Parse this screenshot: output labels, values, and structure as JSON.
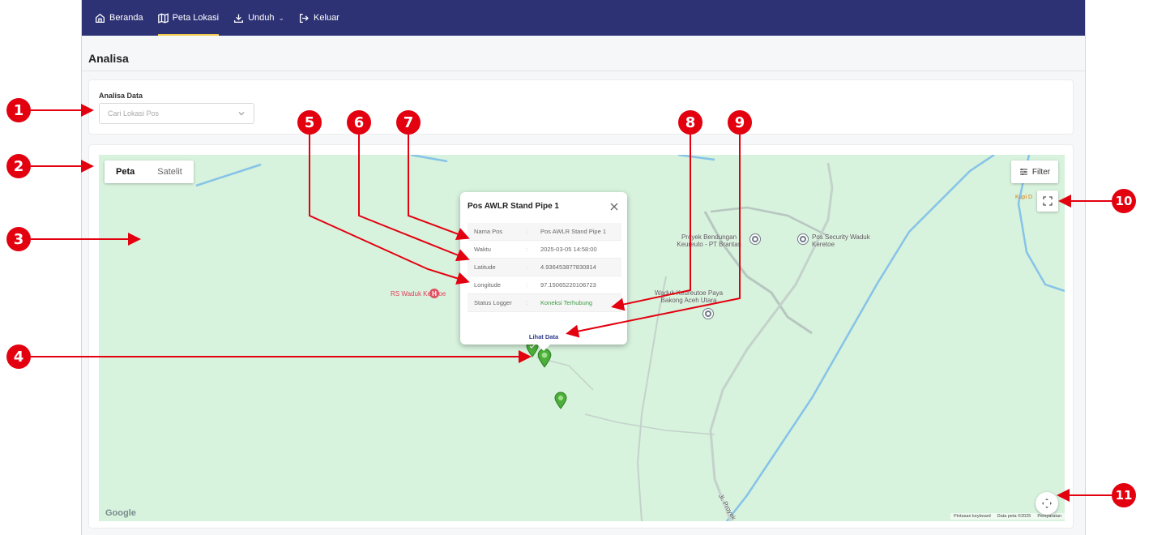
{
  "nav": {
    "items": [
      {
        "label": "Beranda",
        "icon": "home-icon"
      },
      {
        "label": "Peta Lokasi",
        "icon": "map-icon",
        "active": true
      },
      {
        "label": "Unduh",
        "icon": "download-icon",
        "dropdown": true
      },
      {
        "label": "Keluar",
        "icon": "logout-icon"
      }
    ],
    "colors": {
      "bar": "#2d3275",
      "active_underline": "#f2c94c"
    }
  },
  "page": {
    "title": "Analisa"
  },
  "analysis": {
    "label": "Analisa Data",
    "select_placeholder": "Cari Lokasi Pos"
  },
  "map": {
    "type_toggle": {
      "options": [
        "Peta",
        "Satelit"
      ],
      "selected": "Peta"
    },
    "filter_label": "Filter",
    "pois": [
      {
        "name": "RS Waduk Keretoe",
        "color": "#d3384d"
      },
      {
        "name": "Proyek Bendungan Keureuto - PT Brantas"
      },
      {
        "name": "Pos Security Waduk Keretoe"
      },
      {
        "name": "Waduk Keureutoe Paya Bakong Aceh Utara"
      },
      {
        "name": "Kupi D"
      }
    ],
    "road_label": "Jl. Proyek",
    "google_logo": "Google",
    "attribution": [
      "Pintasan keyboard",
      "Data peta ©2025",
      "Persyaratan"
    ],
    "background_color": "#d7f2dd"
  },
  "popup": {
    "title": "Pos AWLR Stand Pipe 1",
    "rows": [
      {
        "key": "Nama Pos",
        "sep": ":",
        "value": "Pos AWLR Stand Pipe 1"
      },
      {
        "key": "Waktu",
        "sep": ":",
        "value": "2025-03-05 14:58:00"
      },
      {
        "key": "Latitude",
        "sep": ":",
        "value": "4.936453877830814"
      },
      {
        "key": "Longitude",
        "sep": ":",
        "value": "97.15065220106723"
      },
      {
        "key": "Status Logger",
        "sep": ":",
        "value": "Koneksi Terhubung",
        "color": "#3a9d44"
      }
    ],
    "link": "Lihat Data"
  },
  "callouts": [
    "1",
    "2",
    "3",
    "4",
    "5",
    "6",
    "7",
    "8",
    "9",
    "10",
    "11"
  ],
  "callout_color": "#e3000f"
}
